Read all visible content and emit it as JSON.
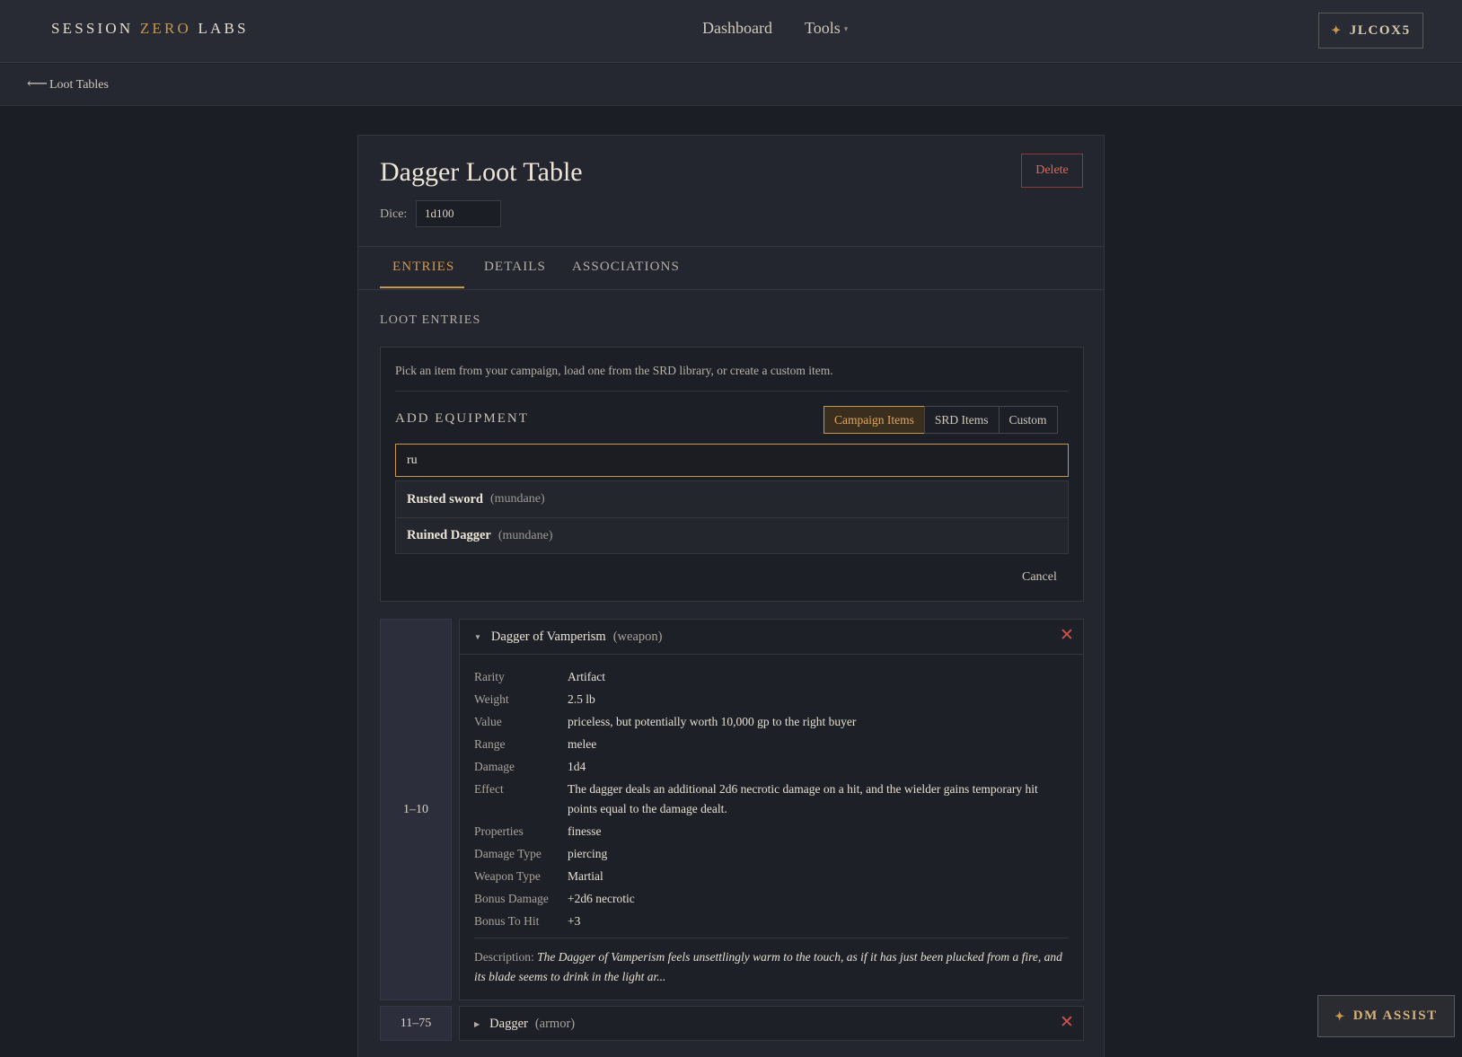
{
  "brand": {
    "part1": "SESSION ",
    "accent": "ZERO",
    "part2": " LABS"
  },
  "nav": {
    "dashboard": "Dashboard",
    "tools": "Tools",
    "tools_caret": "▾"
  },
  "user": {
    "label": "JLCOX5",
    "icon": "✦"
  },
  "breadcrumb": {
    "arrow": "⟵",
    "label": "Loot Tables"
  },
  "table": {
    "title": "Dagger Loot Table",
    "delete_label": "Delete",
    "dice_label": "Dice:",
    "dice_value": "1d100"
  },
  "tabs": [
    {
      "label": "ENTRIES",
      "active": true
    },
    {
      "label": "DETAILS",
      "active": false
    },
    {
      "label": "ASSOCIATIONS",
      "active": false
    }
  ],
  "section_label": "LOOT ENTRIES",
  "add_equipment": {
    "help": "Pick an item from your campaign, load one from the SRD library, or create a custom item.",
    "label": "ADD EQUIPMENT",
    "sources": [
      {
        "label": "Campaign Items",
        "active": true
      },
      {
        "label": "SRD Items",
        "active": false
      },
      {
        "label": "Custom",
        "active": false
      }
    ],
    "search_value": "ru",
    "suggestions": [
      {
        "name": "Rusted sword",
        "tag": "(mundane)"
      },
      {
        "name": "Ruined Dagger",
        "tag": "(mundane)"
      }
    ],
    "cancel_label": "Cancel"
  },
  "entries": [
    {
      "range": "1–10",
      "name": "Dagger of Vamperism",
      "tag": "(weapon)",
      "expanded": true,
      "caret": "▼",
      "properties": [
        {
          "key": "Rarity",
          "value": "Artifact"
        },
        {
          "key": "Weight",
          "value": "2.5 lb"
        },
        {
          "key": "Value",
          "value": "priceless, but potentially worth 10,000 gp to the right buyer"
        },
        {
          "key": "Range",
          "value": "melee"
        },
        {
          "key": "Damage",
          "value": "1d4"
        },
        {
          "key": "Effect",
          "value": "The dagger deals an additional 2d6 necrotic damage on a hit, and the wielder gains temporary hit points equal to the damage dealt."
        },
        {
          "key": "Properties",
          "value": "finesse"
        },
        {
          "key": "Damage Type",
          "value": "piercing"
        },
        {
          "key": "Weapon Type",
          "value": "Martial"
        },
        {
          "key": "Bonus Damage",
          "value": "+2d6 necrotic"
        },
        {
          "key": "Bonus To Hit",
          "value": "+3"
        }
      ],
      "description_label": "Description:",
      "description": "The Dagger of Vamperism feels unsettlingly warm to the touch, as if it has just been plucked from a fire, and its blade seems to drink in the light ar..."
    },
    {
      "range": "11–75",
      "name": "Dagger",
      "tag": "(armor)",
      "expanded": false,
      "caret": "▶"
    }
  ],
  "remove_icon": "✕",
  "dm_assist": {
    "label": "DM ASSIST",
    "icon": "✦"
  },
  "colors": {
    "accent": "#c9964f",
    "danger": "#d0524c",
    "background": "#1c1e26",
    "panel": "#23262e"
  },
  "icons": {
    "back": "arrow-left-icon",
    "remove": "close-icon",
    "expand": "caret-icon",
    "star": "sparkle-icon"
  }
}
